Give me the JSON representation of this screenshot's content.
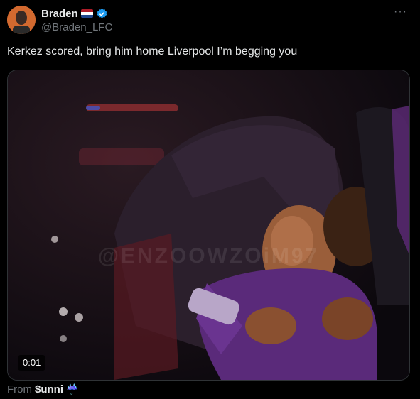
{
  "author": {
    "display_name": "Braden",
    "handle": "@Braden_LFC",
    "flag_icon": "netherlands-flag-icon",
    "verified_icon": "verified-badge-icon"
  },
  "more_icon": "···",
  "tweet": {
    "text": "Kerkez scored, bring him home Liverpool I’m begging you"
  },
  "media": {
    "type": "video",
    "duration": "0:01",
    "watermark": "@ENZOOWZOiM97"
  },
  "footer": {
    "prefix": "From",
    "source_user": "$unni",
    "source_emoji": "☔"
  },
  "colors": {
    "background": "#000000",
    "text": "#e7e9ea",
    "secondary": "#71767b",
    "verified": "#1d9bf0"
  }
}
